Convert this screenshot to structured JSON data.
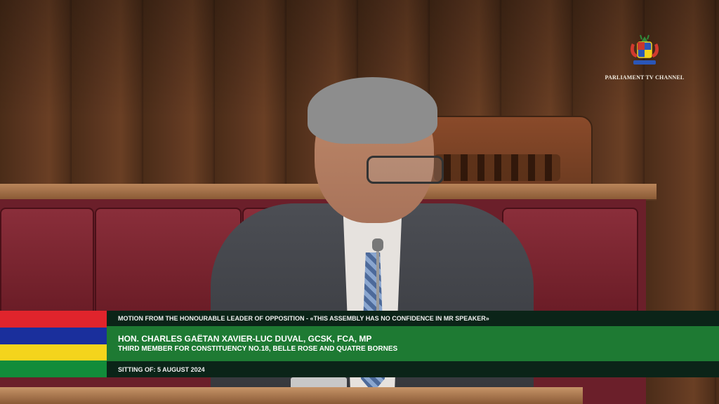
{
  "broadcast": {
    "channel_logo_text": "PARLIAMENT TV CHANNEL"
  },
  "lower_third": {
    "motion": "MOTION FROM THE HONOURABLE LEADER OF OPPOSITION - «THIS ASSEMBLY HAS NO CONFIDENCE IN MR SPEAKER»",
    "speaker_name": "HON. CHARLES GAËTAN XAVIER-LUC DUVAL, GCSK, FCA, MP",
    "speaker_role": "THIRD MEMBER FOR CONSTITUENCY NO.18, BELLE ROSE AND QUATRE BORNES",
    "sitting": "SITTING OF: 5 AUGUST 2024"
  },
  "flag_colors": [
    "#e0242c",
    "#1a2f9c",
    "#f4d41c",
    "#128c3a"
  ],
  "icons": {
    "logo": "coat-of-arms-icon"
  }
}
